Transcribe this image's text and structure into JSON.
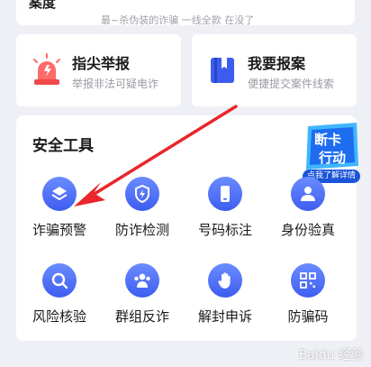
{
  "top_card": {
    "title": "案度",
    "subtitle": "最~杀伪装的诈骗    一线全款    在没了"
  },
  "report_cards": [
    {
      "title": "指尖举报",
      "subtitle": "举报非法可疑电诈",
      "icon": "alarm-light-icon"
    },
    {
      "title": "我要报案",
      "subtitle": "便捷提交案件线索",
      "icon": "case-book-icon"
    }
  ],
  "tools": {
    "title": "安全工具",
    "badge": {
      "line1": "断卡",
      "line2": "行动",
      "ribbon": "点我了解详情"
    },
    "items": [
      {
        "label": "诈骗预警",
        "icon": "layers-icon"
      },
      {
        "label": "防诈检测",
        "icon": "shield-bolt-icon"
      },
      {
        "label": "号码标注",
        "icon": "phone-icon"
      },
      {
        "label": "身份验真",
        "icon": "person-verify-icon"
      },
      {
        "label": "风险核验",
        "icon": "search-icon"
      },
      {
        "label": "群组反诈",
        "icon": "group-icon"
      },
      {
        "label": "解封申诉",
        "icon": "hand-icon"
      },
      {
        "label": "防骗码",
        "icon": "qr-code-icon"
      }
    ]
  },
  "watermark": "Baidu 经验",
  "colors": {
    "accent": "#3d5df0",
    "arrow": "#e8262b",
    "alarm": "#f04848"
  }
}
